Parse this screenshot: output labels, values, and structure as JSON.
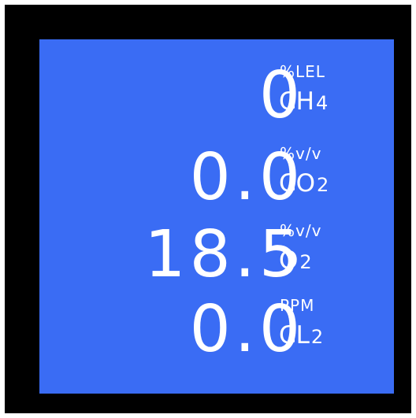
{
  "display": {
    "background_color": "#3a6cf4",
    "bezel_color": "#000000",
    "text_color": "#ffffff",
    "rows": [
      {
        "value": "0",
        "unit": "%LEL",
        "gas": "CH",
        "gas_sub": "4"
      },
      {
        "value": "0.0",
        "unit": "%v/v",
        "gas": "CO",
        "gas_sub": "2"
      },
      {
        "value": "18.5",
        "unit": "%v/v",
        "gas": "O",
        "gas_sub": "2"
      },
      {
        "value": "0.0",
        "unit": "PPM",
        "gas": "CL",
        "gas_sub": "2"
      }
    ]
  }
}
